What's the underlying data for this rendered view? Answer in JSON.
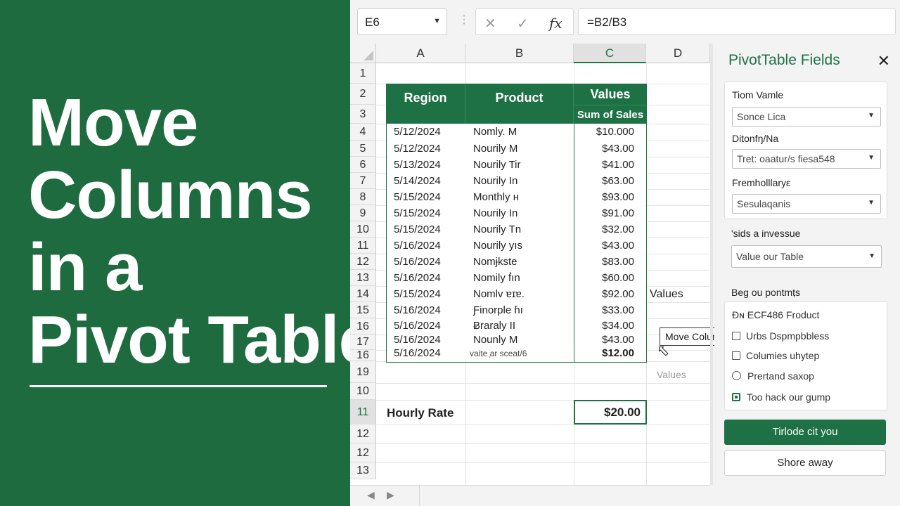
{
  "banner": {
    "title_lines": [
      "Move",
      "Columns",
      "in a",
      "Pivot Table"
    ]
  },
  "formula_bar": {
    "name_box": "E6",
    "cancel_icon": "✕",
    "enter_icon": "✓",
    "fx_label": "fx",
    "formula": "=B2/B3"
  },
  "grid": {
    "columns": [
      "A",
      "B",
      "C",
      "D"
    ],
    "row_numbers": [
      "1",
      "2",
      "3",
      "4",
      "5",
      "6",
      "7",
      "8",
      "9",
      "10",
      "11",
      "12",
      "13",
      "14",
      "15",
      "16",
      "17",
      "16",
      "19",
      "10",
      "11",
      "12",
      "12",
      "13"
    ],
    "header": {
      "region": "Region",
      "product": "Product",
      "values": "Values",
      "sum_of_sales": "Sum of Sales"
    },
    "rows": [
      {
        "date": "5/12/2024",
        "product": "Nomly. M",
        "value": "$10.000"
      },
      {
        "date": "5/12/2024",
        "product": "Nourily M",
        "value": "$43.00"
      },
      {
        "date": "5/13/2024",
        "product": "Nourily Tir",
        "value": "$41.00"
      },
      {
        "date": "5/14/2024",
        "product": "Nourily In",
        "value": "$63.00"
      },
      {
        "date": "5/15/2024",
        "product": "Monthly н",
        "value": "$93.00"
      },
      {
        "date": "5/15/2024",
        "product": "Nourily In",
        "value": "$91.00"
      },
      {
        "date": "5/15/2024",
        "product": "Nourily Tn",
        "value": "$32.00"
      },
      {
        "date": "5/16/2024",
        "product": "Nourily yıs",
        "value": "$43.00"
      },
      {
        "date": "5/16/2024",
        "product": "Nomɉkste",
        "value": "$83.00"
      },
      {
        "date": "5/16/2024",
        "product": "Nomily ḟın",
        "value": "$60.00"
      },
      {
        "date": "5/15/2024",
        "product": "Nomlv ɐɪɐ.",
        "value": "$92.00"
      },
      {
        "date": "5/16/2024",
        "product": "Ƒinorple ɦı",
        "value": "$33.00"
      },
      {
        "date": "5/16/2024",
        "product": "Ƀraraly II",
        "value": "$34.00"
      },
      {
        "date": "5/16/2024",
        "product": "Nounly M",
        "value": "$43.00"
      },
      {
        "date": "5/16/2024",
        "product": "vaite ̦ar sceat/6",
        "value": "$12.00"
      }
    ],
    "d_values_label": "Values",
    "tooltip": "Move Columns",
    "drag_values_label": "Values",
    "hourly_label": "Hourly Rate",
    "hourly_value": "$20.00"
  },
  "pivot_panel": {
    "title": "PivotTable Fields",
    "close_icon": "✕",
    "field1": {
      "label": "Tiom Vamle",
      "value": "Sonce Lica"
    },
    "field2": {
      "label": "Ditonfŋ/Na",
      "value": "Tret: oaatur/ѕ fiesa548"
    },
    "field3": {
      "label": "Fremholllaryε",
      "value": "Sesulaqanis"
    },
    "section2": {
      "label": "ʹsids a invessue",
      "value": "Value our Table"
    },
    "list_title": "Beg ou pontmṭs",
    "list_items": [
      "Ðɴ ECF486 Froduct",
      "Urbs Dspmpbbless",
      "Columies uhytep",
      "Prertand saxop",
      "Too hack our gump"
    ],
    "primary_button": "Tirlode cit you",
    "secondary_button": "Shore away"
  },
  "colors": {
    "banner_green": "#1d6b3e",
    "excel_green": "#1e7145"
  }
}
